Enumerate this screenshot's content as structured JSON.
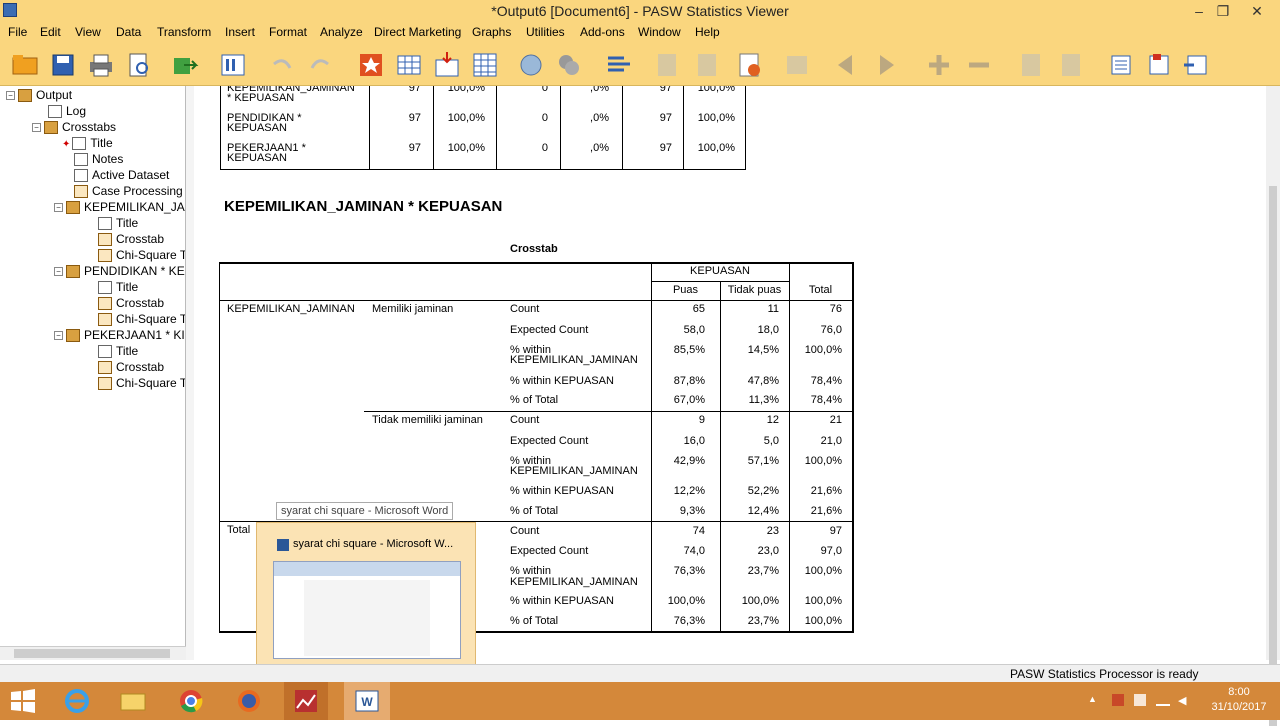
{
  "window": {
    "title": "*Output6 [Document6] - PASW Statistics Viewer",
    "minimize": "–",
    "restore": "❐",
    "close": "✕"
  },
  "menu": [
    "File",
    "Edit",
    "View",
    "Data",
    "Transform",
    "Insert",
    "Format",
    "Analyze",
    "Direct Marketing",
    "Graphs",
    "Utilities",
    "Add-ons",
    "Window",
    "Help"
  ],
  "outline": {
    "output": "Output",
    "log": "Log",
    "crosstabs": "Crosstabs",
    "title": "Title",
    "notes": "Notes",
    "active_dataset": "Active Dataset",
    "case_processing": "Case Processing",
    "group1": "KEPEMILIKAN_JA",
    "group2": "PENDIDIKAN * KE",
    "group3": "PEKERJAAN1 * KI",
    "sub_title": "Title",
    "sub_crosstab": "Crosstab",
    "sub_chi": "Chi-Square T"
  },
  "summary_rows": [
    {
      "label1": "KEPEMILIKAN_JAMINAN",
      "label2": "* KEPUASAN",
      "n1": "97",
      "p1": "100,0%",
      "n2": "0",
      "p2": ",0%",
      "n3": "97",
      "p3": "100,0%"
    },
    {
      "label1": "PENDIDIKAN *",
      "label2": "KEPUASAN",
      "n1": "97",
      "p1": "100,0%",
      "n2": "0",
      "p2": ",0%",
      "n3": "97",
      "p3": "100,0%"
    },
    {
      "label1": "PEKERJAAN1 *",
      "label2": "KEPUASAN",
      "n1": "97",
      "p1": "100,0%",
      "n2": "0",
      "p2": ",0%",
      "n3": "97",
      "p3": "100,0%"
    }
  ],
  "section_title": "KEPEMILIKAN_JAMINAN * KEPUASAN",
  "crosstab": {
    "caption": "Crosstab",
    "col_group": "KEPUASAN",
    "col_puas": "Puas",
    "col_tidak": "Tidak puas",
    "col_total": "Total",
    "row_var": "KEPEMILIKAN_JAMINAN",
    "grp1": "Memiliki jaminan",
    "grp2": "Tidak memiliki jaminan",
    "grp_total": "Total",
    "stat_count": "Count",
    "stat_expected": "Expected Count",
    "stat_within_row_1": "% within",
    "stat_within_row_2": "KEPEMILIKAN_JAMINAN",
    "stat_within_col": "% within KEPUASAN",
    "stat_of_total": "% of Total",
    "g1": {
      "count": [
        "65",
        "11",
        "76"
      ],
      "expected": [
        "58,0",
        "18,0",
        "76,0"
      ],
      "within_row": [
        "85,5%",
        "14,5%",
        "100,0%"
      ],
      "within_col": [
        "87,8%",
        "47,8%",
        "78,4%"
      ],
      "of_total": [
        "67,0%",
        "11,3%",
        "78,4%"
      ]
    },
    "g2": {
      "count": [
        "9",
        "12",
        "21"
      ],
      "expected": [
        "16,0",
        "5,0",
        "21,0"
      ],
      "within_row": [
        "42,9%",
        "57,1%",
        "100,0%"
      ],
      "within_col": [
        "12,2%",
        "52,2%",
        "21,6%"
      ],
      "of_total": [
        "9,3%",
        "12,4%",
        "21,6%"
      ]
    },
    "gt": {
      "count": [
        "74",
        "23",
        "97"
      ],
      "expected": [
        "74,0",
        "23,0",
        "97,0"
      ],
      "within_row": [
        "76,3%",
        "23,7%",
        "100,0%"
      ],
      "within_col": [
        "100,0%",
        "100,0%",
        "100,0%"
      ],
      "of_total": [
        "76,3%",
        "23,7%",
        "100,0%"
      ]
    }
  },
  "tooltip": "syarat chi square - Microsoft Word",
  "popup_title": "syarat chi square - Microsoft W...",
  "status": "PASW Statistics Processor is ready",
  "clock": {
    "time": "8:00",
    "date": "31/10/2017"
  }
}
